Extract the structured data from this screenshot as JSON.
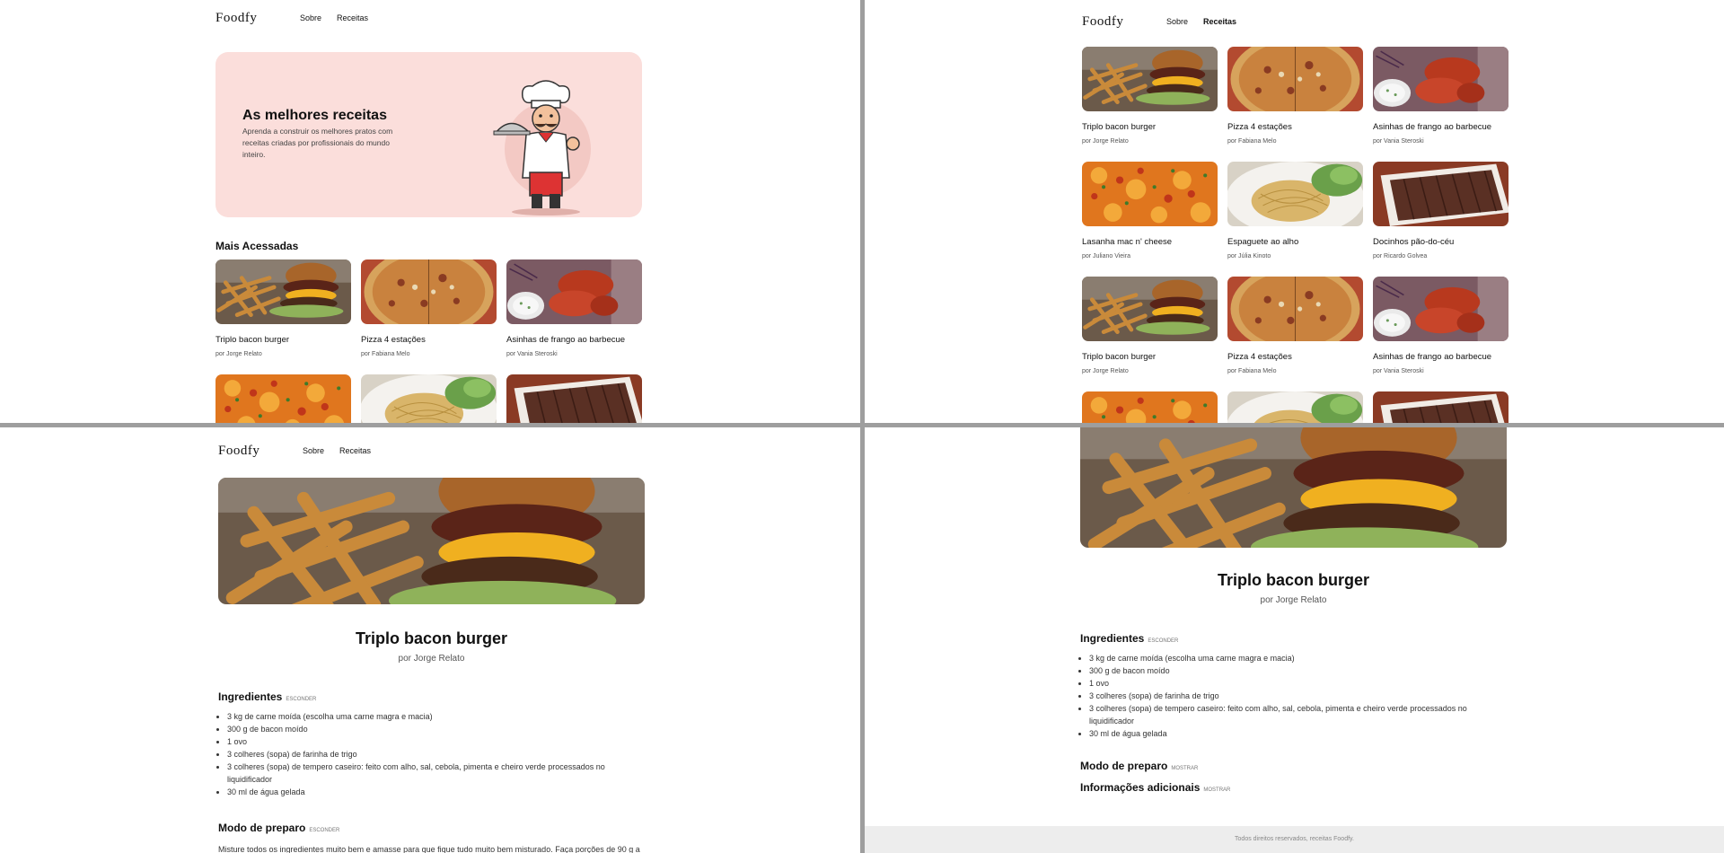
{
  "brand": "Foodfy",
  "nav": {
    "about": "Sobre",
    "recipes": "Receitas"
  },
  "home": {
    "hero_title": "As melhores receitas",
    "hero_text": "Aprenda a construir os melhores pratos com receitas criadas por profissionais do mundo inteiro.",
    "section_title": "Mais Acessadas"
  },
  "recipes": [
    {
      "title": "Triplo bacon burger",
      "author": "por Jorge Relato",
      "image": "burger"
    },
    {
      "title": "Pizza 4 estações",
      "author": "por Fabiana Melo",
      "image": "pizza"
    },
    {
      "title": "Asinhas de frango ao barbecue",
      "author": "por Vania Steroski",
      "image": "wings"
    },
    {
      "title": "Lasanha mac n' cheese",
      "author": "por Juliano Vieira",
      "image": "lasagna"
    },
    {
      "title": "Espaguete ao alho",
      "author": "por Júlia Kinoto",
      "image": "spaghetti"
    },
    {
      "title": "Docinhos pão-do-céu",
      "author": "por Ricardo Golvea",
      "image": "chocolates"
    }
  ],
  "detail": {
    "title": "Triplo bacon burger",
    "author": "por Jorge Relato",
    "ingredients_title": "Ingredientes",
    "hide_label": "ESCONDER",
    "show_label": "MOSTRAR",
    "ingredients": [
      "3 kg de carne moída (escolha uma carne magra e macia)",
      "300 g de bacon moído",
      "1 ovo",
      "3 colheres (sopa) de farinha de trigo",
      "3 colheres (sopa) de tempero caseiro: feito com alho, sal, cebola, pimenta e cheiro verde processados no liquidificador",
      "30 ml de água gelada"
    ],
    "preparation_title": "Modo de preparo",
    "preparation_text": "Misture todos os ingredientes muito bem e amasse para que fique tudo muito bem misturado. Faça porções de 90 g a",
    "extra_title": "Informações adicionais"
  },
  "footer": "Todos direitos reservados, receitas Foodfy.",
  "colors": {
    "hero_bg": "#fbdedb",
    "footer_bg": "#ededed"
  }
}
